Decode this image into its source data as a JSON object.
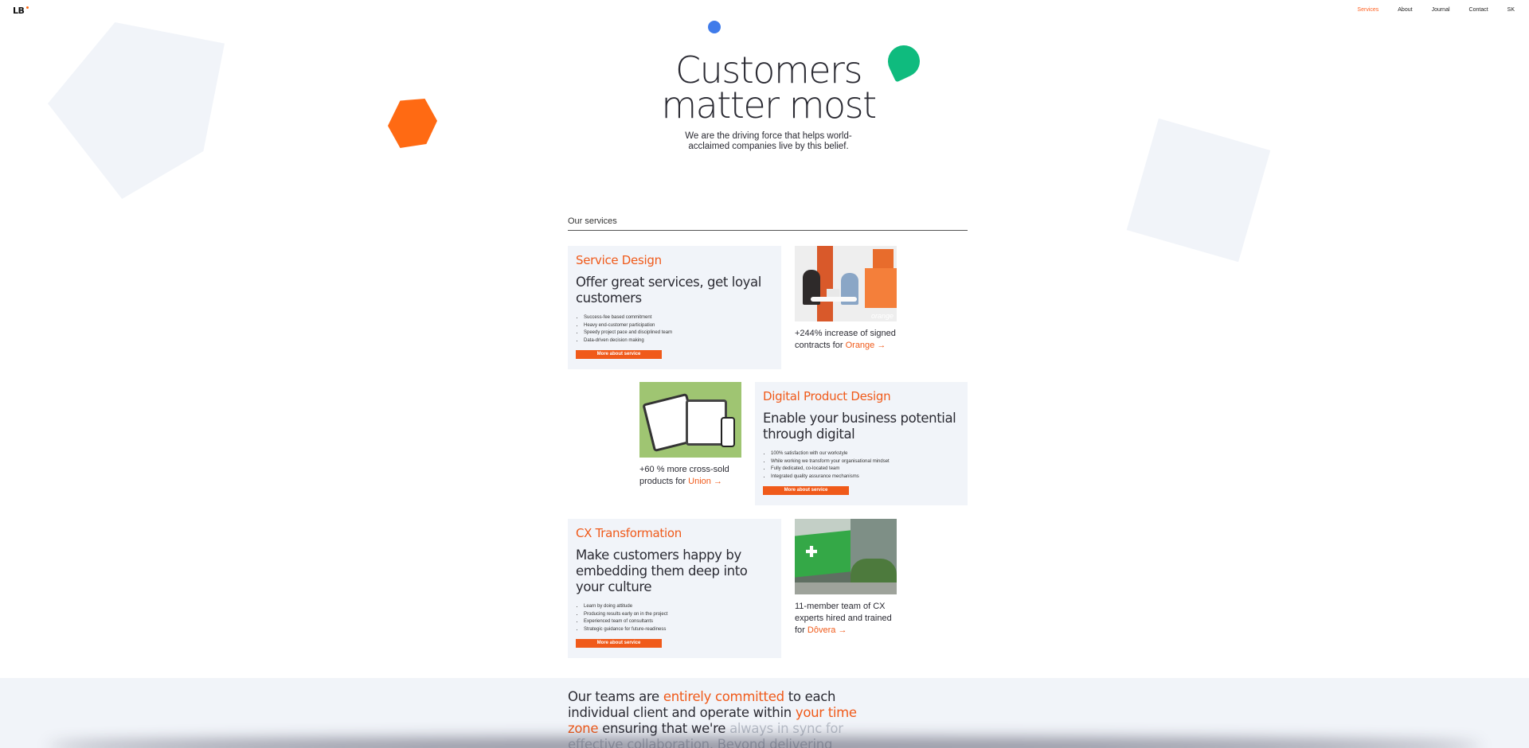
{
  "nav": {
    "logo": "LB",
    "items": [
      {
        "label": "Services",
        "active": true
      },
      {
        "label": "About"
      },
      {
        "label": "Journal"
      },
      {
        "label": "Contact"
      },
      {
        "label": "SK"
      }
    ]
  },
  "hero": {
    "title_line1": "Customers",
    "title_line2": "matter most",
    "subtitle": "We are the driving force that helps world-acclaimed companies live by this belief."
  },
  "services": {
    "heading": "Our services",
    "items": [
      {
        "title": "Service Design",
        "headline": "Offer great services, get loyal customers",
        "bullets": [
          "Success-fee based commitment",
          "Heavy end-customer participation",
          "Speedy project pace and disciplined team",
          "Data-driven decision making"
        ],
        "button": "More about service",
        "case_text": "+244% increase of signed contracts for",
        "case_client": "Orange",
        "image_tag": "orange"
      },
      {
        "title": "Digital Product Design",
        "headline": "Enable your business potential through digital",
        "bullets": [
          "100% satisfaction with our workstyle",
          "While working we transform your organisational mindset",
          "Fully dedicated, co-located team",
          "Integrated quality assurance mechanisms"
        ],
        "button": "More about service",
        "case_text": "+60 % more cross-sold products for",
        "case_client": "Union"
      },
      {
        "title": "CX Transformation",
        "headline": "Make customers happy by embedding them deep into your culture",
        "bullets": [
          "Learn by doing attitude",
          "Producing results early on in the project",
          "Experienced team of consultants",
          "Strategic guidance for future-readiness"
        ],
        "button": "More about service",
        "case_text": "11-member team of CX experts hired and trained for",
        "case_client": "Dôvera"
      }
    ]
  },
  "bottom": {
    "t1": "Our teams are ",
    "h1": "entirely committed",
    "t2": " to each individual client and operate within ",
    "h2": "your time zone",
    "t3": " ensuring that we're ",
    "m1": "always in sync for effective collaboration. Beyond delivering results, we also"
  },
  "colors": {
    "accent": "#f05a1a",
    "card_bg": "#f1f4f9",
    "blue_dot": "#3f7bea",
    "green_drop": "#0fbb7e",
    "orange_hex": "#ff6a13"
  },
  "icons": {
    "case_link": "arrow-right-icon"
  }
}
